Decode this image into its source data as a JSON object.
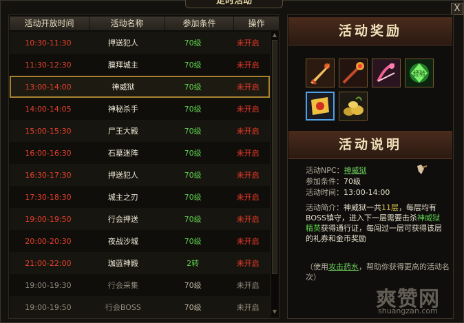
{
  "window": {
    "title": "定时活动",
    "close_label": "X"
  },
  "table": {
    "headers": [
      "活动开放时间",
      "活动名称",
      "参加条件",
      "操作"
    ],
    "rows": [
      {
        "time": "10:30-11:30",
        "name": "押送犯人",
        "level": "70级",
        "status": "未开启"
      },
      {
        "time": "11:30-12:30",
        "name": "膜拜城主",
        "level": "70级",
        "status": "未开启"
      },
      {
        "time": "13:00-14:00",
        "name": "神威狱",
        "level": "70级",
        "status": "未开启"
      },
      {
        "time": "14:00-14:05",
        "name": "神秘杀手",
        "level": "70级",
        "status": "未开启"
      },
      {
        "time": "15:00-15:30",
        "name": "尸王大殿",
        "level": "70级",
        "status": "未开启"
      },
      {
        "time": "16:00-16:30",
        "name": "石墓迷阵",
        "level": "70级",
        "status": "未开启"
      },
      {
        "time": "16:30-17:30",
        "name": "押送犯人",
        "level": "70级",
        "status": "未开启"
      },
      {
        "time": "17:30-18:30",
        "name": "城主之刃",
        "level": "70级",
        "status": "未开启"
      },
      {
        "time": "19:00-19:50",
        "name": "行会押送",
        "level": "70级",
        "status": "未开启"
      },
      {
        "time": "20:00-20:30",
        "name": "夜战沙城",
        "level": "70级",
        "status": "未开启"
      },
      {
        "time": "21:00-22:00",
        "name": "珈蓝神殿",
        "level": "2转",
        "status": "未开启"
      },
      {
        "time": "19:00-19:30",
        "name": "行会采集",
        "level": "70级",
        "status": "未开启"
      },
      {
        "time": "19:00-19:50",
        "name": "行会BOSS",
        "level": "70级",
        "status": "未开启"
      }
    ]
  },
  "reward": {
    "title": "活动奖励",
    "items": [
      "sword-icon",
      "staff-icon",
      "fan-icon",
      "green-gem-icon",
      "scroll-icon",
      "gold-pile-icon"
    ]
  },
  "info": {
    "title": "活动说明",
    "npc_label": "活动NPC：",
    "npc_value": "神威狱",
    "cond_label": "参加条件：",
    "cond_value": "70级",
    "time_label": "活动时间：",
    "time_value": "13:00-14:00",
    "intro_label": "活动简介：",
    "intro_a": "神威狱一共",
    "intro_floors": "11层",
    "intro_b": "，每层均有BOSS镇守，进入下一层需要击杀",
    "intro_elite": "神威狱精英",
    "intro_c": "获得通行证，每闯过一层可获得该层的礼券和金币奖励",
    "tip_a": "（使用",
    "tip_link": "攻击药水",
    "tip_b": "，帮助你获得更高的活动名次）"
  },
  "watermark": {
    "big": "爽赞网",
    "small": "shuangzan.com"
  }
}
